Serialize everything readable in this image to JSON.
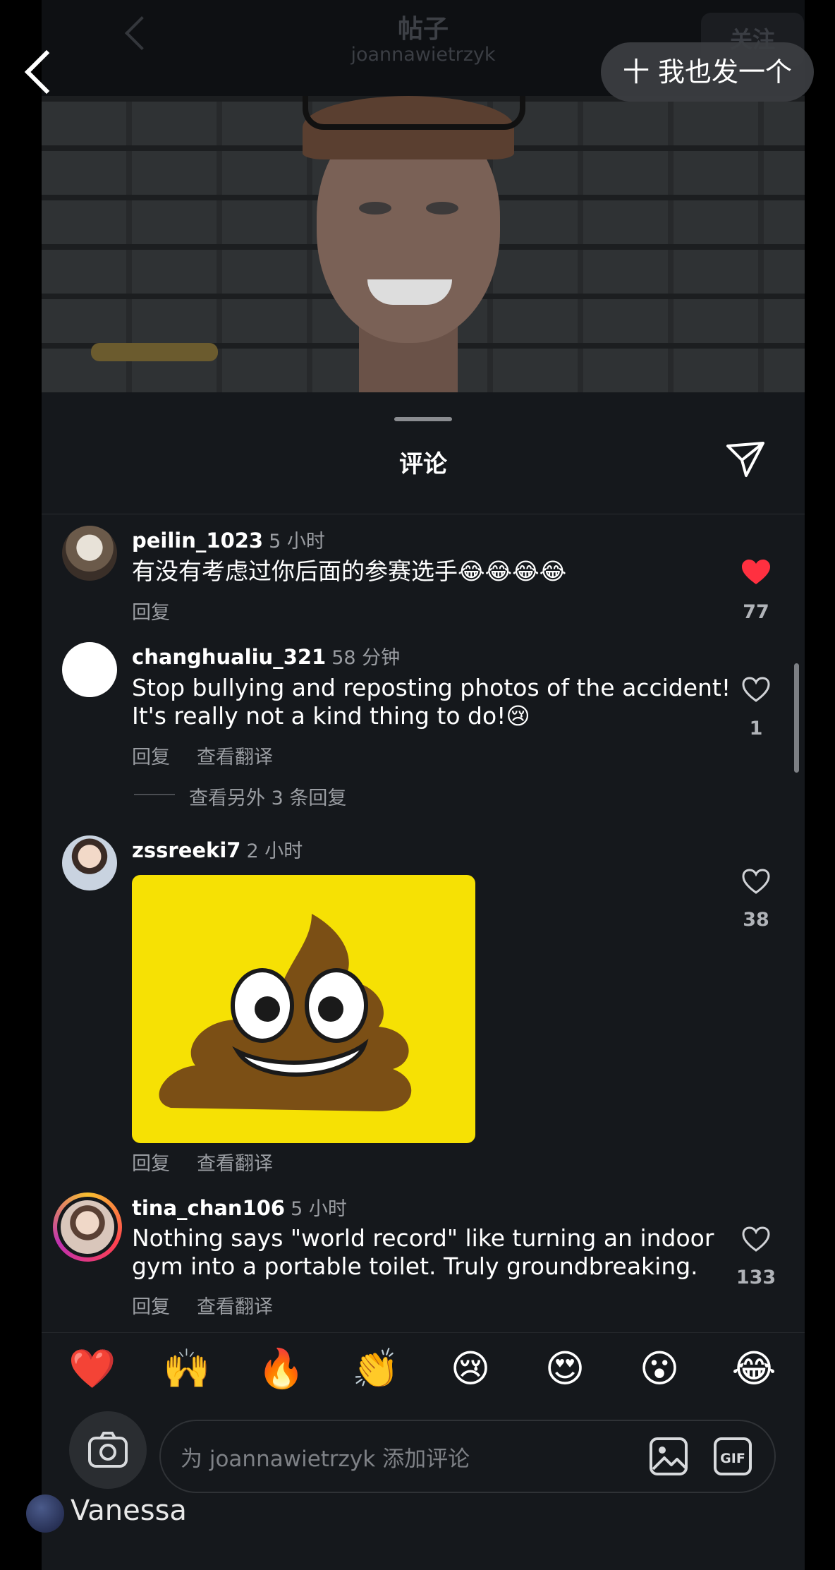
{
  "header": {
    "title": "帖子",
    "subtitle": "joannawietrzyk",
    "follow_label": "关注",
    "post_button_label": "十 我也发一个"
  },
  "sheet": {
    "title": "评论"
  },
  "comments": [
    {
      "username": "peilin_1023",
      "time": "5 小时",
      "text": "有没有考虑过你后面的参赛选手😂😂😂😂",
      "reply_label": "回复",
      "liked": true,
      "like_count": "77"
    },
    {
      "username": "changhualiu_321",
      "time": "58 分钟",
      "text_line1": "Stop bullying and reposting photos of the accident!",
      "text_line2": "It's really not a kind thing to do!😢",
      "reply_label": "回复",
      "translate_label": "查看翻译",
      "more_replies_label": "查看另外 3 条回复",
      "liked": false,
      "like_count": "1"
    },
    {
      "username": "zssreeki7",
      "time": "2 小时",
      "image": "poop-emoji-sticker",
      "reply_label": "回复",
      "translate_label": "查看翻译",
      "liked": false,
      "like_count": "38"
    },
    {
      "username": "tina_chan106",
      "time": "5 小时",
      "text_line1": "Nothing says \"world record\" like turning an indoor",
      "text_line2": "gym into a portable toilet. Truly groundbreaking.",
      "reply_label": "回复",
      "translate_label": "查看翻译",
      "liked": false,
      "like_count": "133"
    }
  ],
  "emoji_bar": [
    "❤️",
    "🙌",
    "🔥",
    "👏",
    "😢",
    "😍",
    "😮",
    "😂"
  ],
  "input": {
    "placeholder": "为 joannawietrzyk 添加评论"
  },
  "footer": {
    "user_label": "Vanessa"
  },
  "colors": {
    "background": "#15181c",
    "like_red": "#ff3040",
    "muted_text": "#9a9da2"
  }
}
